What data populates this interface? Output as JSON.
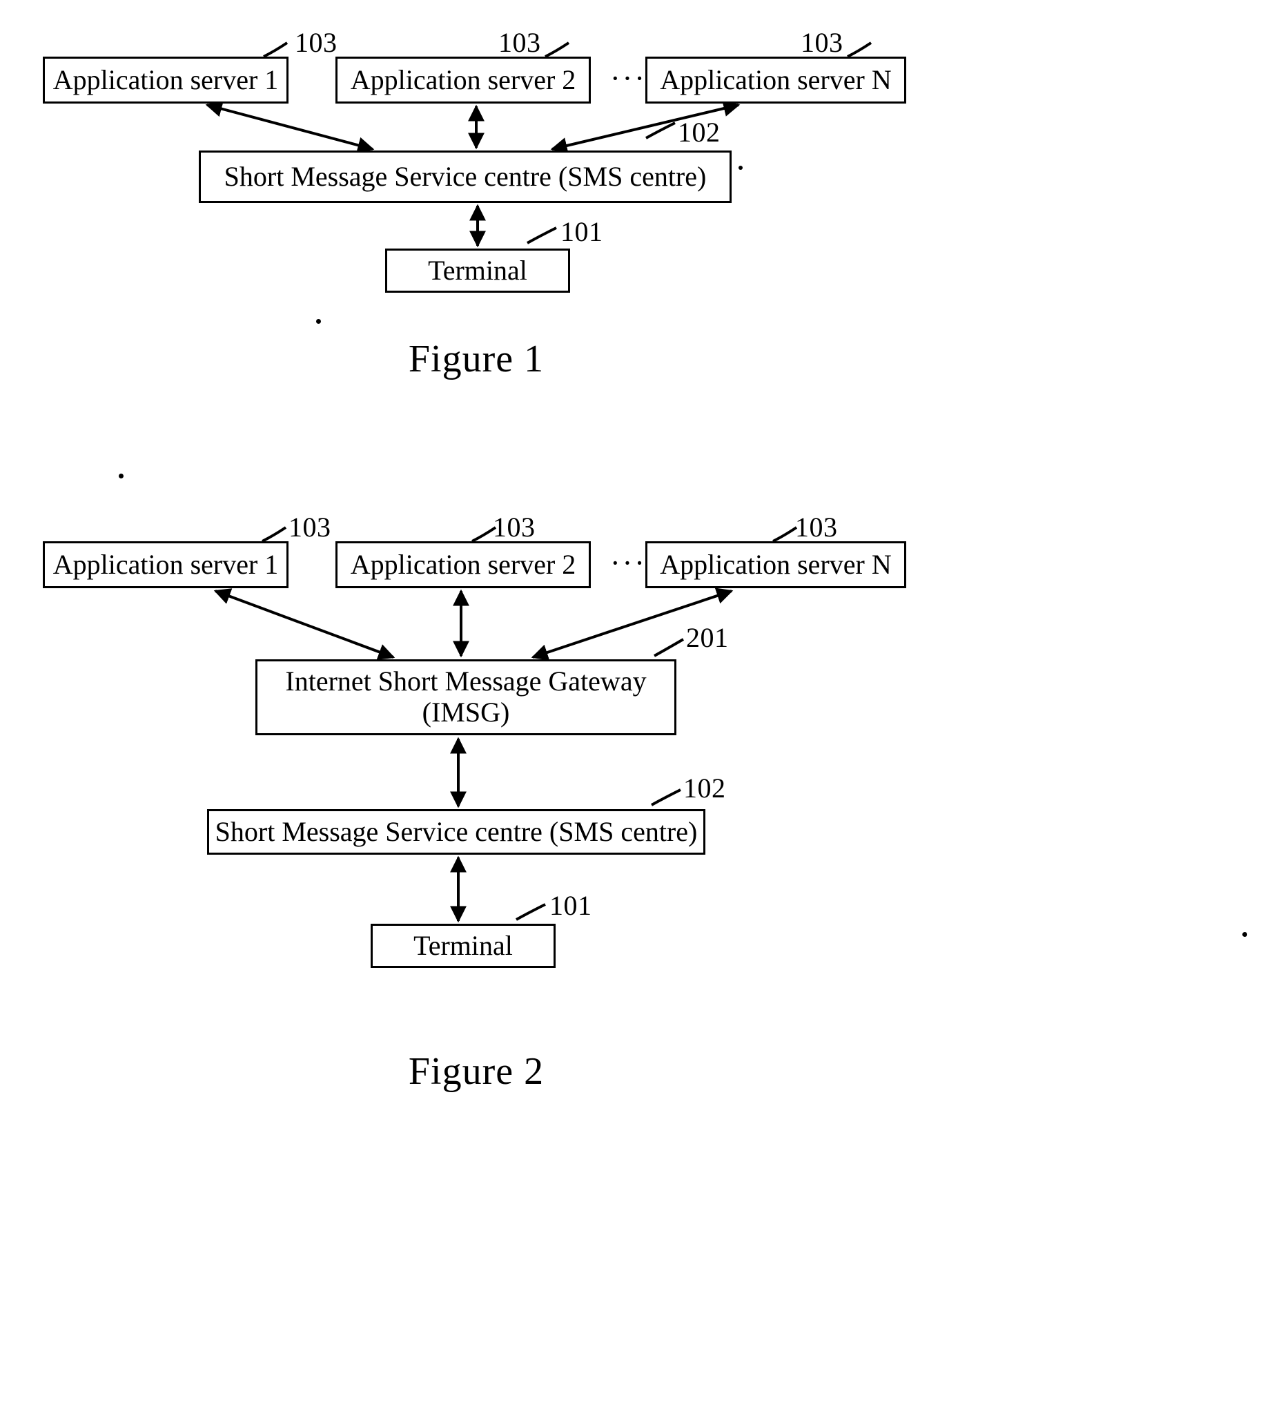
{
  "document": {
    "type": "patent-drawing-sheet",
    "background_color": "#ffffff",
    "ink_color": "#000000"
  },
  "figures": [
    {
      "id": "figure-1",
      "caption": "Figure 1",
      "nodes": [
        {
          "id": "f1-as1",
          "label": "Application server  1",
          "ref": "103"
        },
        {
          "id": "f1-as2",
          "label": "Application server 2",
          "ref": "103"
        },
        {
          "id": "f1-asn",
          "label": "Application server N",
          "ref": "103"
        },
        {
          "id": "f1-smsc",
          "label": "Short Message Service centre (SMS centre)",
          "ref": "102"
        },
        {
          "id": "f1-term",
          "label": "Terminal",
          "ref": "101"
        }
      ],
      "ellipsis": "···",
      "refs": {
        "as1": "103",
        "as2": "103",
        "asn": "103",
        "smsc": "102",
        "terminal": "101"
      }
    },
    {
      "id": "figure-2",
      "caption": "Figure 2",
      "nodes": [
        {
          "id": "f2-as1",
          "label": "Application server 1",
          "ref": "103"
        },
        {
          "id": "f2-as2",
          "label": "Application server 2",
          "ref": "103"
        },
        {
          "id": "f2-asn",
          "label": "Application server N",
          "ref": "103"
        },
        {
          "id": "f2-imsg",
          "label": "Internet Short Message Gateway\n(IMSG)",
          "ref": "201"
        },
        {
          "id": "f2-smsc",
          "label": "Short Message Service centre (SMS centre)",
          "ref": "102"
        },
        {
          "id": "f2-term",
          "label": "Terminal",
          "ref": "101"
        }
      ],
      "ellipsis": "···",
      "refs": {
        "as1": "103",
        "as2": "103",
        "asn": "103",
        "imsg": "201",
        "smsc": "102",
        "terminal": "101"
      }
    }
  ]
}
